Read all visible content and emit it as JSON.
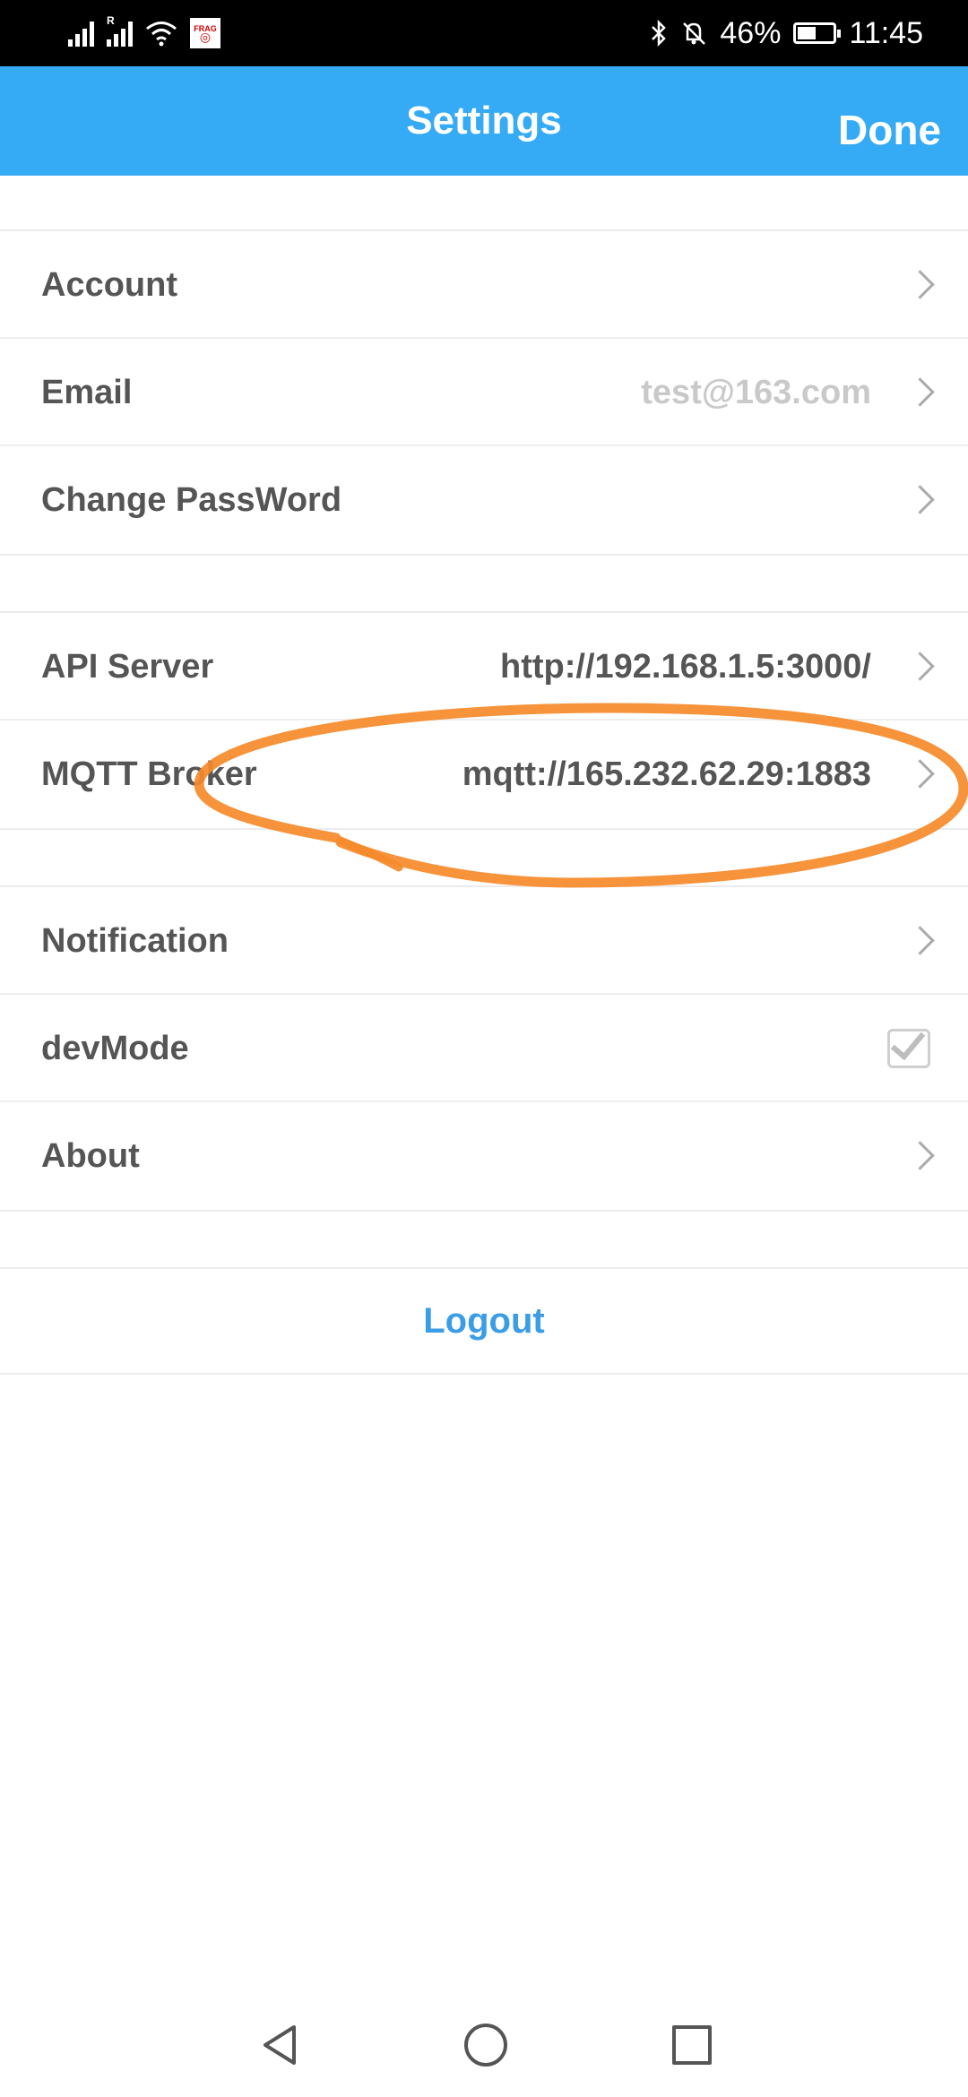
{
  "status_bar": {
    "network_tag": "R",
    "frag_label": "FRAG",
    "battery_percent": "46%",
    "battery_level": 0.46,
    "time": "11:45"
  },
  "header": {
    "title": "Settings",
    "done_label": "Done"
  },
  "groups": [
    {
      "rows": [
        {
          "label": "Account",
          "value": "",
          "control": "chevron"
        },
        {
          "label": "Email",
          "value": "test@163.com",
          "control": "chevron"
        },
        {
          "label": "Change PassWord",
          "value": "",
          "control": "chevron"
        }
      ]
    },
    {
      "rows": [
        {
          "label": "API Server",
          "value": "http://192.168.1.5:3000/",
          "control": "chevron"
        },
        {
          "label": "MQTT Broker",
          "value": "mqtt://165.232.62.29:1883",
          "control": "chevron"
        }
      ]
    },
    {
      "rows": [
        {
          "label": "Notification",
          "value": "",
          "control": "chevron"
        },
        {
          "label": "devMode",
          "value": "",
          "control": "checkbox",
          "checked": true
        },
        {
          "label": "About",
          "value": "",
          "control": "chevron"
        }
      ]
    }
  ],
  "logout_label": "Logout",
  "colors": {
    "header": "#35aaf5",
    "logout": "#3a9de6",
    "annotation": "#f58a2a"
  },
  "nav": {
    "back_icon": "triangle-back-icon",
    "home_icon": "circle-home-icon",
    "recent_icon": "square-recents-icon"
  }
}
